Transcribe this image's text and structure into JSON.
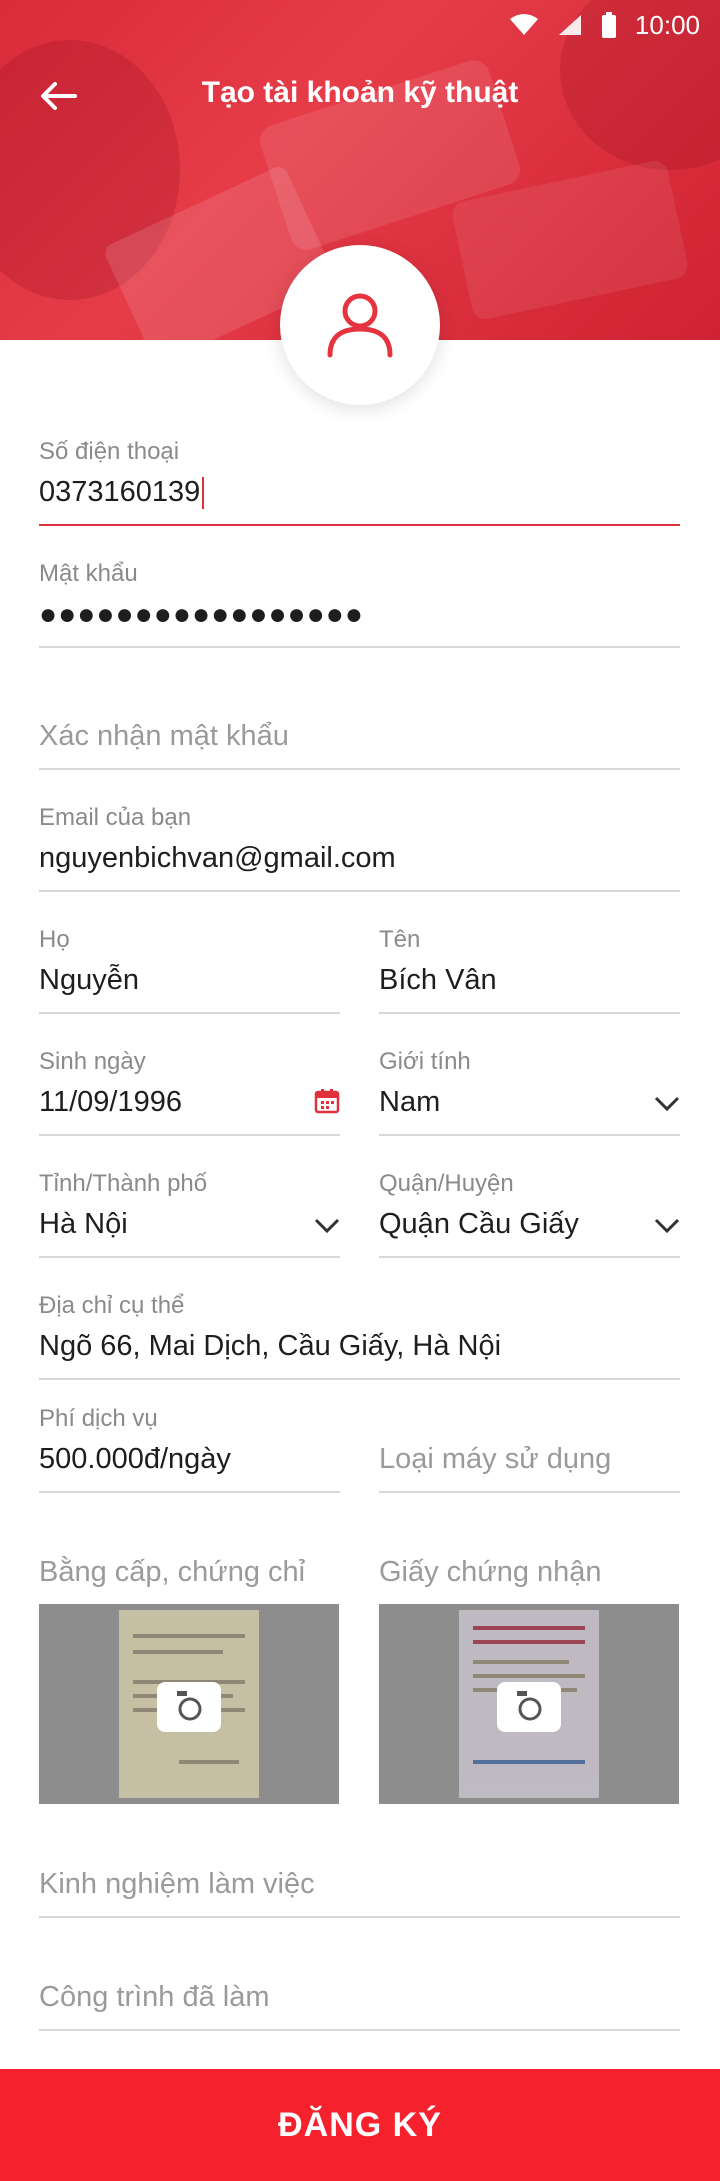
{
  "status_bar": {
    "time": "10:00",
    "icons": [
      "wifi-icon",
      "signal-icon",
      "battery-icon"
    ]
  },
  "header": {
    "title": "Tạo tài khoản kỹ thuật",
    "back_icon": "arrow-left-icon",
    "avatar_icon": "user-icon"
  },
  "form": {
    "phone": {
      "label": "Số điện thoại",
      "value": "0373160139"
    },
    "password": {
      "label": "Mật khẩu",
      "value": "●●●●●●●●●●●●●●●●●"
    },
    "confirm_password": {
      "placeholder": "Xác nhận mật khẩu"
    },
    "email": {
      "label": "Email của bạn",
      "value": "nguyenbichvan@gmail.com"
    },
    "last_name": {
      "label": "Họ",
      "value": "Nguyễn"
    },
    "first_name": {
      "label": "Tên",
      "value": "Bích Vân"
    },
    "birthday": {
      "label": "Sinh ngày",
      "value": "11/09/1996"
    },
    "gender": {
      "label": "Giới tính",
      "value": "Nam"
    },
    "province": {
      "label": "Tỉnh/Thành phố",
      "value": "Hà Nội"
    },
    "district": {
      "label": "Quận/Huyện",
      "value": "Quận Cầu Giấy"
    },
    "address": {
      "label": "Địa chỉ cụ thể",
      "value": "Ngõ 66, Mai Dịch, Cầu Giấy, Hà Nội"
    },
    "service_fee": {
      "label": "Phí dịch vụ",
      "value": "500.000đ/ngày"
    },
    "machine_type": {
      "placeholder": "Loại máy sử dụng"
    },
    "degree": {
      "title": "Bằng cấp, chứng chỉ"
    },
    "certificate": {
      "title": "Giấy chứng nhận"
    },
    "experience": {
      "placeholder": "Kinh nghiệm làm việc"
    },
    "projects": {
      "placeholder": "Công trình đã làm"
    }
  },
  "submit": {
    "label": "ĐĂNG KÝ"
  },
  "colors": {
    "primary": "#f5222d",
    "header": "#e03340",
    "underline": "#d9d9d9"
  }
}
